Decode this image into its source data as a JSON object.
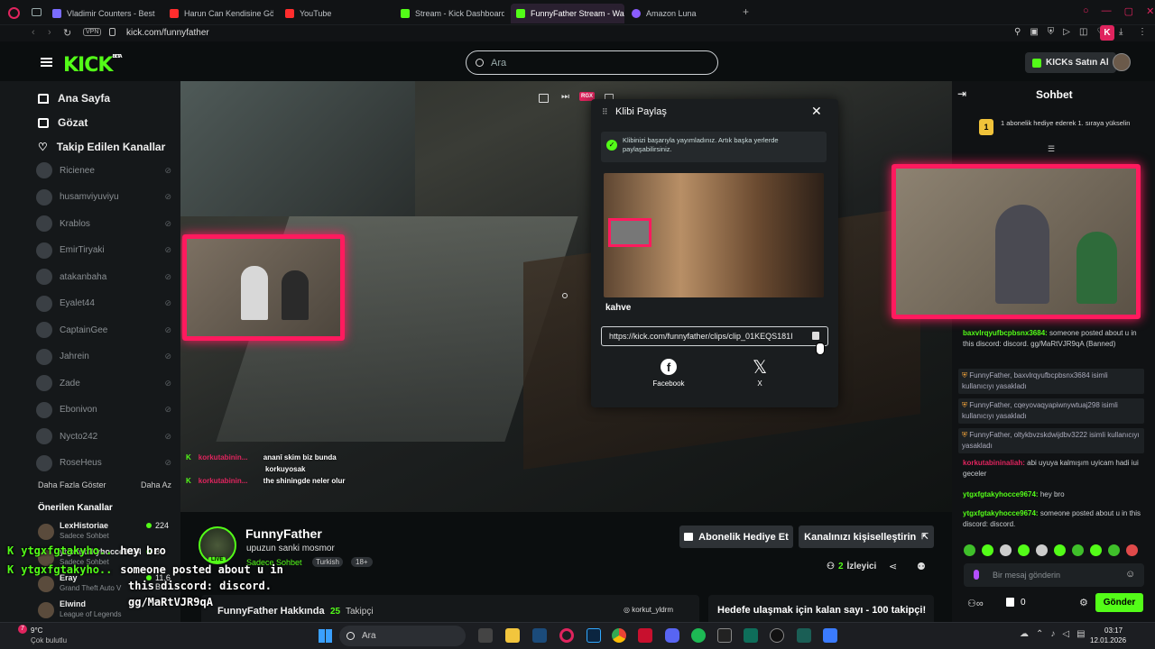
{
  "browser": {
    "tabs": [
      {
        "label": "Vladimir Counters - Best &",
        "color": "#7a6cff"
      },
      {
        "label": "Harun Can Kendisine Göre",
        "color": "#ff2d2d"
      },
      {
        "label": "YouTube",
        "color": "#ff2d2d"
      },
      {
        "label": "Stream - Kick Dashboard",
        "color": "#53fc18"
      },
      {
        "label": "FunnyFather Stream - Wa",
        "color": "#53fc18"
      },
      {
        "label": "Amazon Luna",
        "color": "#8a5cff"
      }
    ],
    "vpn_label": "VPN",
    "url": "kick.com/funnyfather",
    "profile_letter": "K"
  },
  "header": {
    "logo": "KICK",
    "logo_badge": "BETA",
    "search_placeholder": "Ara",
    "buy_kicks": "KICKs Satın Al"
  },
  "sidebar": {
    "nav": [
      {
        "label": "Ana Sayfa",
        "icon": "home-icon"
      },
      {
        "label": "Gözat",
        "icon": "browse-icon"
      },
      {
        "label": "Takip Edilen Kanallar",
        "icon": "heart-icon"
      }
    ],
    "channels": [
      "Ricienee",
      "husamviyuviyu",
      "Krablos",
      "EmirTiryaki",
      "atakanbaha",
      "Eyalet44",
      "CaptainGee",
      "Jahrein",
      "Zade",
      "Ebonivon",
      "Nycto242",
      "RoseHeus"
    ],
    "show_more": "Daha Fazla Göster",
    "show_less": "Daha Az",
    "recommended_title": "Önerilen Kanallar",
    "recommended": [
      {
        "name": "LexHistoriae",
        "sub": "Sadece Sohbet",
        "viewers": "224"
      },
      {
        "name": "ytgxfgtakyhocce9674",
        "sub": "Sadece Sohbet",
        "viewers": "8"
      },
      {
        "name": "Eray",
        "sub": "Grand Theft Auto V",
        "viewers": "11.6 B"
      },
      {
        "name": "Elwind",
        "sub": "League of Legends",
        "viewers": ""
      }
    ]
  },
  "video": {
    "controls": [
      "picture-in-picture",
      "next",
      "RGX",
      "theater"
    ],
    "overlay_chat": [
      {
        "user": "korkutabinin...",
        "text": "ananî skim biz bunda"
      },
      {
        "user": "",
        "text": "korkuyosak"
      },
      {
        "user": "korkutabinin...",
        "text": "the shiningde neler olur"
      }
    ]
  },
  "clip_modal": {
    "title": "Klibi Paylaş",
    "success": "Klibinizi başarıyla yayımladınız. Artık başka yerlerde paylaşabilirsiniz.",
    "clip_title": "kahve",
    "clip_url": "https://kick.com/funnyfather/clips/clip_01KEQS181I",
    "share": [
      {
        "label": "Facebook",
        "icon": "facebook-icon"
      },
      {
        "label": "X",
        "icon": "x-icon"
      }
    ]
  },
  "stream": {
    "name": "FunnyFather",
    "title": "upuzun sanki mosmor",
    "category": "Sadece Sohbet",
    "tags": [
      "Turkish",
      "18+"
    ],
    "live": "LIVE",
    "gift_sub": "Abonelik Hediye Et",
    "customize": "Kanalınızı kişiselleştirin",
    "viewers_count": "2",
    "viewers_label": "İzleyici",
    "about": "FunnyFather Hakkında",
    "followers_count": "25",
    "followers_label": "Takipçi",
    "goal": "Hedefe ulaşmak için kalan sayı - 100 takipçi!",
    "social": "korkut_yldrm"
  },
  "chat": {
    "title": "Sohbet",
    "pinned": "1 abonelik hediye ederek 1. sıraya yükselin",
    "pinned_rank": "1",
    "messages": [
      {
        "type": "msg",
        "user": "baxvlrqyufbcpbsnx3684:",
        "text": "someone posted about u in this discord: discord. gg/MaRtVJR9qA (Banned)"
      },
      {
        "type": "sys",
        "text": "FunnyFather, baxvlrqyufbcpbsnx3684 isimli kullanıcıyı yasakladı"
      },
      {
        "type": "sys",
        "text": "FunnyFather, cqeyovaqyapiwnywtuaj298 isimli kullanıcıyı yasakladı"
      },
      {
        "type": "sys",
        "text": "FunnyFather, oltykbvzskdwijdbv3222 isimli kullanıcıyı yasakladı"
      },
      {
        "type": "msg",
        "user": "korkutabininaliah:",
        "text": "abi uyuya kalmışım uyicam hadi iui geceler"
      },
      {
        "type": "msg",
        "user": "ytgxfgtakyhocce9674:",
        "text": "hey bro"
      },
      {
        "type": "msg",
        "user": "ytgxfgtakyhocce9674:",
        "text": "someone posted about u in this discord: discord."
      }
    ],
    "input_placeholder": "Bir mesaj gönderin",
    "points": "0",
    "send": "Gönder"
  },
  "overlay_bottom": [
    {
      "user": "ytgxfgtakyho...",
      "text": "hey bro"
    },
    {
      "user": "ytgxfgtakyho...",
      "text": "someone posted about u in"
    },
    {
      "user": "",
      "text": "this discord: discord."
    },
    {
      "user": "",
      "text": "gg/MaRtVJR9qA"
    }
  ],
  "taskbar": {
    "weather_temp": "9°C",
    "weather_desc": "Çok bulutlu",
    "search": "Ara",
    "time": "03:17",
    "date": "12.01.2026",
    "badge": "7"
  },
  "colors": {
    "accent": "#53fc18",
    "frame": "#ff1a5e"
  }
}
